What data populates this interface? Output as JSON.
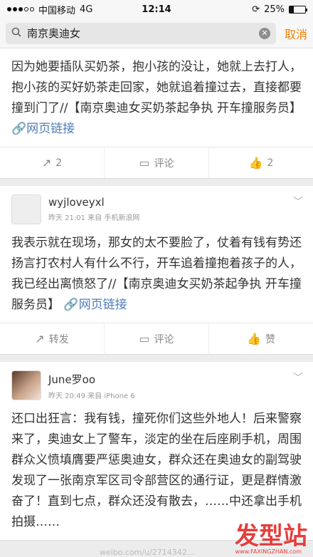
{
  "status_bar": {
    "carrier": "中国移动",
    "network": "4G",
    "time": "12:14",
    "battery": "25%",
    "battery_level": 0.25
  },
  "search": {
    "query": "南京奥迪女",
    "cancel_label": "取消"
  },
  "cards": [
    {
      "text": "因为她要插队买奶茶，抱小孩的没让，她就上去打人，抱小孩的买好奶茶走回家，她就追着撞过去，直接都要撞到门了//【南京奥迪女买奶茶起争执 开车撞服务员】",
      "link_label": "网页链接",
      "actions": {
        "repost": "2",
        "comment": "评论",
        "like": "2"
      }
    },
    {
      "username": "wyjloveyxl",
      "meta": "昨天 21:01  来自 手机新浪网",
      "text": "我表示就在现场，那女的太不要脸了，仗着有钱有势还扬言打农村人有什么不行，开车追着撞抱着孩子的人，我已经出离愤怒了//【南京奥迪女买奶茶起争执 开车撞服务员】",
      "link_label": "网页链接",
      "actions": {
        "repost": "转发",
        "comment": "评论",
        "like": "赞"
      }
    },
    {
      "username": "June罗oo",
      "meta": "昨天 20:49  来自 iPhone 6",
      "text": "还口出狂言：我有钱，撞死你们这些外地人！后来警察来了，奥迪女上了警车，淡定的坐在后座刷手机，周围群众义愤填膺要严惩奥迪女，群众还在奥迪女的副驾驶发现了一张南京军区司令部营区的通行证，更是群情激奋了！直到七点，群众还没有散去，……中还拿出手机拍摄……"
    }
  ],
  "watermark": {
    "logo": "发型站",
    "url": "www.FAXINGZHAN.com",
    "footer": "weibo.com/u/2714342…"
  }
}
